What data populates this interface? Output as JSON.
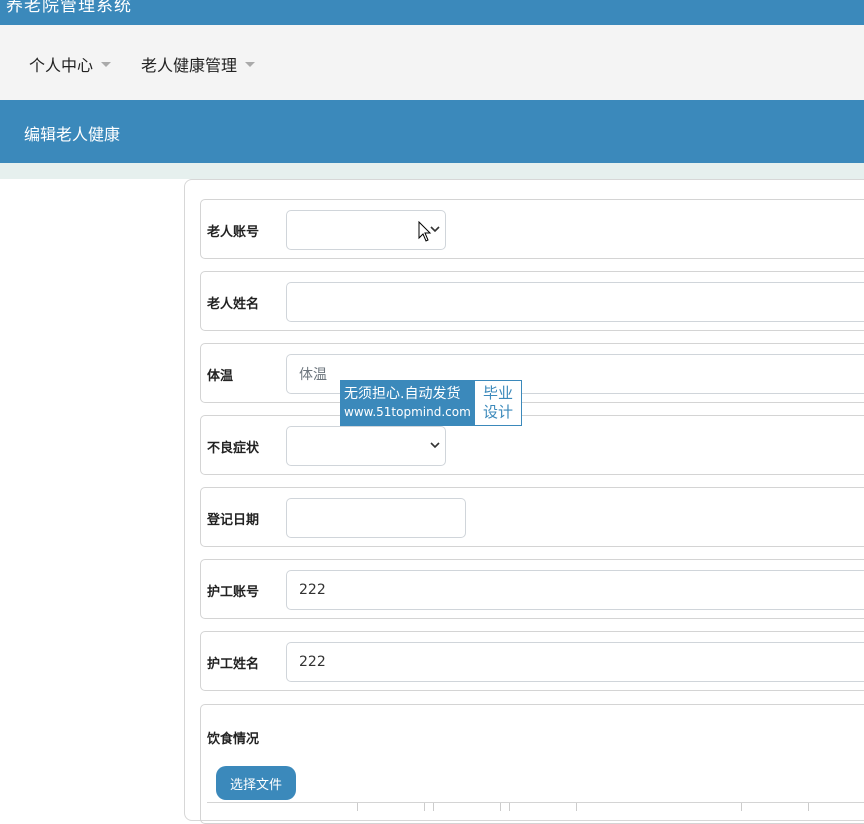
{
  "topbar": {
    "title": "养老院管理系统"
  },
  "nav": {
    "items": [
      {
        "label": "个人中心"
      },
      {
        "label": "老人健康管理"
      }
    ]
  },
  "page": {
    "heading": "编辑老人健康"
  },
  "form": {
    "elder_account": {
      "label": "老人账号",
      "value": ""
    },
    "elder_name": {
      "label": "老人姓名",
      "value": ""
    },
    "temperature": {
      "label": "体温",
      "placeholder": "体温",
      "value": ""
    },
    "symptoms": {
      "label": "不良症状",
      "value": ""
    },
    "reg_date": {
      "label": "登记日期",
      "value": ""
    },
    "nurse_account": {
      "label": "护工账号",
      "value": "222"
    },
    "nurse_name": {
      "label": "护工姓名",
      "value": "222"
    },
    "diet": {
      "label": "饮食情况",
      "file_button": "选择文件"
    }
  },
  "watermark": {
    "line1": "无须担心.自动发货",
    "line2": "www.51topmind.com",
    "badge1": "毕业",
    "badge2": "设计"
  },
  "colors": {
    "primary": "#3b89bb",
    "nav_bg": "#f4f4f4",
    "strip": "#e6f0ee"
  }
}
